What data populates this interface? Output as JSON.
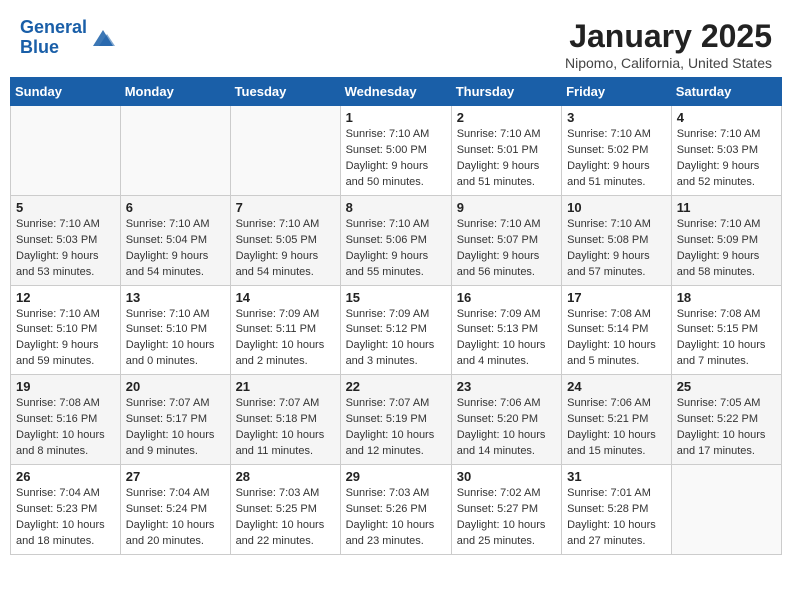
{
  "header": {
    "logo_line1": "General",
    "logo_line2": "Blue",
    "title": "January 2025",
    "subtitle": "Nipomo, California, United States"
  },
  "days_of_week": [
    "Sunday",
    "Monday",
    "Tuesday",
    "Wednesday",
    "Thursday",
    "Friday",
    "Saturday"
  ],
  "weeks": [
    [
      {
        "day": "",
        "info": ""
      },
      {
        "day": "",
        "info": ""
      },
      {
        "day": "",
        "info": ""
      },
      {
        "day": "1",
        "info": "Sunrise: 7:10 AM\nSunset: 5:00 PM\nDaylight: 9 hours\nand 50 minutes."
      },
      {
        "day": "2",
        "info": "Sunrise: 7:10 AM\nSunset: 5:01 PM\nDaylight: 9 hours\nand 51 minutes."
      },
      {
        "day": "3",
        "info": "Sunrise: 7:10 AM\nSunset: 5:02 PM\nDaylight: 9 hours\nand 51 minutes."
      },
      {
        "day": "4",
        "info": "Sunrise: 7:10 AM\nSunset: 5:03 PM\nDaylight: 9 hours\nand 52 minutes."
      }
    ],
    [
      {
        "day": "5",
        "info": "Sunrise: 7:10 AM\nSunset: 5:03 PM\nDaylight: 9 hours\nand 53 minutes."
      },
      {
        "day": "6",
        "info": "Sunrise: 7:10 AM\nSunset: 5:04 PM\nDaylight: 9 hours\nand 54 minutes."
      },
      {
        "day": "7",
        "info": "Sunrise: 7:10 AM\nSunset: 5:05 PM\nDaylight: 9 hours\nand 54 minutes."
      },
      {
        "day": "8",
        "info": "Sunrise: 7:10 AM\nSunset: 5:06 PM\nDaylight: 9 hours\nand 55 minutes."
      },
      {
        "day": "9",
        "info": "Sunrise: 7:10 AM\nSunset: 5:07 PM\nDaylight: 9 hours\nand 56 minutes."
      },
      {
        "day": "10",
        "info": "Sunrise: 7:10 AM\nSunset: 5:08 PM\nDaylight: 9 hours\nand 57 minutes."
      },
      {
        "day": "11",
        "info": "Sunrise: 7:10 AM\nSunset: 5:09 PM\nDaylight: 9 hours\nand 58 minutes."
      }
    ],
    [
      {
        "day": "12",
        "info": "Sunrise: 7:10 AM\nSunset: 5:10 PM\nDaylight: 9 hours\nand 59 minutes."
      },
      {
        "day": "13",
        "info": "Sunrise: 7:10 AM\nSunset: 5:10 PM\nDaylight: 10 hours\nand 0 minutes."
      },
      {
        "day": "14",
        "info": "Sunrise: 7:09 AM\nSunset: 5:11 PM\nDaylight: 10 hours\nand 2 minutes."
      },
      {
        "day": "15",
        "info": "Sunrise: 7:09 AM\nSunset: 5:12 PM\nDaylight: 10 hours\nand 3 minutes."
      },
      {
        "day": "16",
        "info": "Sunrise: 7:09 AM\nSunset: 5:13 PM\nDaylight: 10 hours\nand 4 minutes."
      },
      {
        "day": "17",
        "info": "Sunrise: 7:08 AM\nSunset: 5:14 PM\nDaylight: 10 hours\nand 5 minutes."
      },
      {
        "day": "18",
        "info": "Sunrise: 7:08 AM\nSunset: 5:15 PM\nDaylight: 10 hours\nand 7 minutes."
      }
    ],
    [
      {
        "day": "19",
        "info": "Sunrise: 7:08 AM\nSunset: 5:16 PM\nDaylight: 10 hours\nand 8 minutes."
      },
      {
        "day": "20",
        "info": "Sunrise: 7:07 AM\nSunset: 5:17 PM\nDaylight: 10 hours\nand 9 minutes."
      },
      {
        "day": "21",
        "info": "Sunrise: 7:07 AM\nSunset: 5:18 PM\nDaylight: 10 hours\nand 11 minutes."
      },
      {
        "day": "22",
        "info": "Sunrise: 7:07 AM\nSunset: 5:19 PM\nDaylight: 10 hours\nand 12 minutes."
      },
      {
        "day": "23",
        "info": "Sunrise: 7:06 AM\nSunset: 5:20 PM\nDaylight: 10 hours\nand 14 minutes."
      },
      {
        "day": "24",
        "info": "Sunrise: 7:06 AM\nSunset: 5:21 PM\nDaylight: 10 hours\nand 15 minutes."
      },
      {
        "day": "25",
        "info": "Sunrise: 7:05 AM\nSunset: 5:22 PM\nDaylight: 10 hours\nand 17 minutes."
      }
    ],
    [
      {
        "day": "26",
        "info": "Sunrise: 7:04 AM\nSunset: 5:23 PM\nDaylight: 10 hours\nand 18 minutes."
      },
      {
        "day": "27",
        "info": "Sunrise: 7:04 AM\nSunset: 5:24 PM\nDaylight: 10 hours\nand 20 minutes."
      },
      {
        "day": "28",
        "info": "Sunrise: 7:03 AM\nSunset: 5:25 PM\nDaylight: 10 hours\nand 22 minutes."
      },
      {
        "day": "29",
        "info": "Sunrise: 7:03 AM\nSunset: 5:26 PM\nDaylight: 10 hours\nand 23 minutes."
      },
      {
        "day": "30",
        "info": "Sunrise: 7:02 AM\nSunset: 5:27 PM\nDaylight: 10 hours\nand 25 minutes."
      },
      {
        "day": "31",
        "info": "Sunrise: 7:01 AM\nSunset: 5:28 PM\nDaylight: 10 hours\nand 27 minutes."
      },
      {
        "day": "",
        "info": ""
      }
    ]
  ]
}
